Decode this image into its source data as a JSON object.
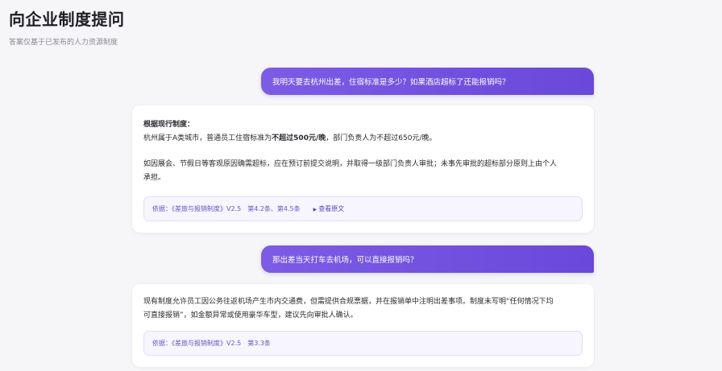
{
  "header": {
    "title": "向企业制度提问",
    "subtitle": "答案仅基于已发布的人力资源制度"
  },
  "conversation": [
    {
      "question": "我明天要去杭州出差，住宿标准是多少？如果酒店超标了还能报销吗？",
      "answer": {
        "heading": "根据现行制度：",
        "line1_pre": "杭州属于A类城市，普通员工住宿标准为",
        "line1_bold": "不超过500元/晚",
        "line1_post": "，部门负责人为不超过650元/晚。",
        "para2_line1": "如因展会、节假日等客观原因确需超标，应在预订前提交说明，并取得一级部门负责人审批；未事先审批的超标部分原则上由个人",
        "para2_line2": "承担。"
      },
      "source": {
        "doc": "依据：《差旅与报销制度》V2.5",
        "clauses": "第4.2条、第4.5条",
        "view_label": "查看原文"
      }
    },
    {
      "question": "那出差当天打车去机场，可以直接报销吗？",
      "answer": {
        "line1": "现有制度允许员工因公务往返机场产生市内交通费，但需提供合规票据，并在报销单中注明出差事项。制度未写明“任何情况下均",
        "line2": "可直接报销”，如金额异常或使用豪华车型，建议先向审批人确认。"
      },
      "source": {
        "doc": "依据：《差旅与报销制度》V2.5",
        "clauses": "第3.3条"
      }
    }
  ]
}
